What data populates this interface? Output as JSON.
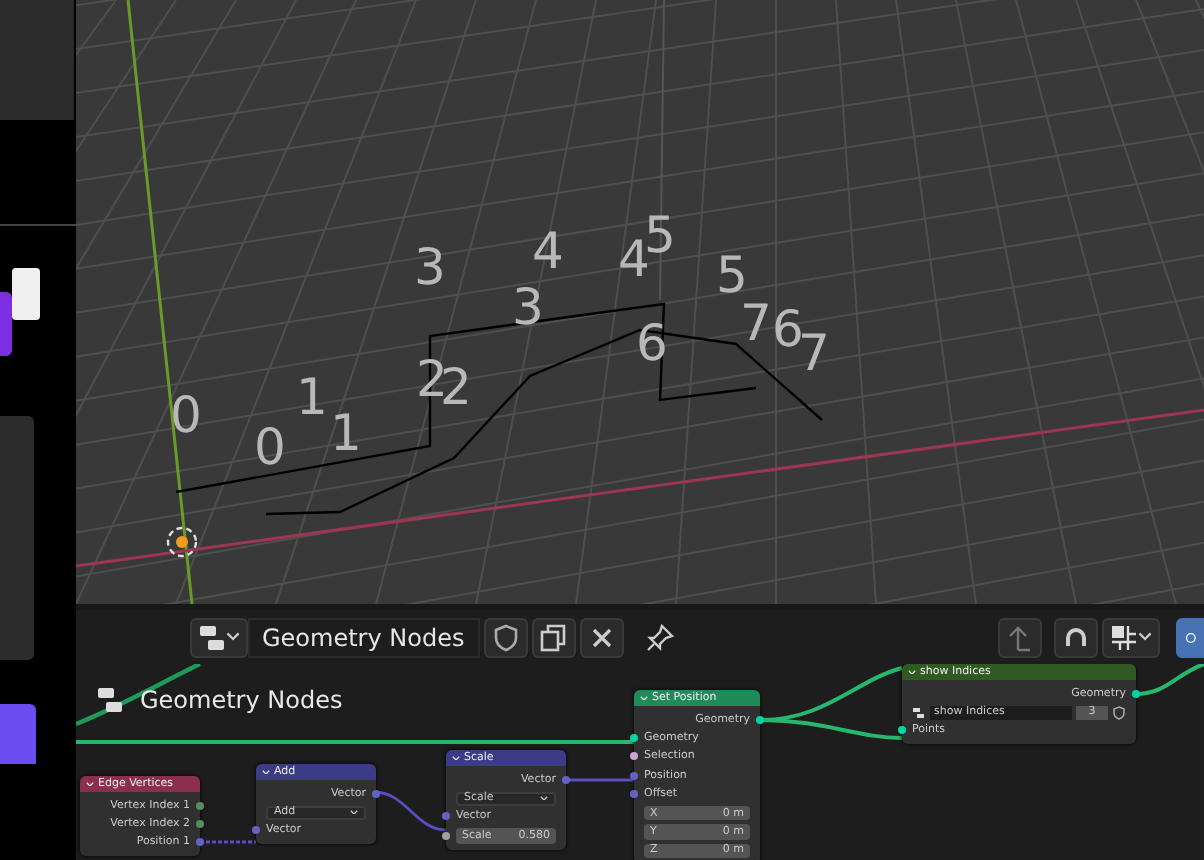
{
  "viewport": {
    "index_labels": [
      {
        "text": "0"
      },
      {
        "text": "0"
      },
      {
        "text": "1"
      },
      {
        "text": "1"
      },
      {
        "text": "2"
      },
      {
        "text": "2"
      },
      {
        "text": "3"
      },
      {
        "text": "3"
      },
      {
        "text": "4"
      },
      {
        "text": "4"
      },
      {
        "text": "5"
      },
      {
        "text": "5"
      },
      {
        "text": "6"
      },
      {
        "text": "7"
      },
      {
        "text": "6"
      },
      {
        "text": "7"
      }
    ]
  },
  "node_editor": {
    "header": {
      "tree_name": "Geometry Nodes"
    },
    "breadcrumb": "Geometry Nodes",
    "nodes": [
      {
        "title": "Edge Vertices",
        "kind": "field",
        "rows": [
          {
            "kind": "output",
            "label": "Vertex Index 1",
            "color": "#598c5c"
          },
          {
            "kind": "output",
            "label": "Vertex Index 2",
            "color": "#598c5c"
          },
          {
            "kind": "output",
            "label": "Position 1",
            "color": "#6363c7"
          }
        ]
      },
      {
        "title": "Add",
        "kind": "vector",
        "rows": [
          {
            "kind": "output",
            "label": "Vector",
            "color": "#6363c7"
          },
          {
            "kind": "dropdown",
            "label": "Add"
          },
          {
            "kind": "input",
            "label": "Vector",
            "color": "#6363c7"
          }
        ]
      },
      {
        "title": "Scale",
        "kind": "vector",
        "rows": [
          {
            "kind": "output",
            "label": "Vector",
            "color": "#6363c7"
          },
          {
            "kind": "dropdown",
            "label": "Scale"
          },
          {
            "kind": "input",
            "label": "Vector",
            "color": "#6363c7"
          },
          {
            "kind": "field",
            "label": "Scale",
            "value": "0.580",
            "color": "#a1a1a1"
          }
        ]
      },
      {
        "title": "Set Position",
        "kind": "geometry",
        "rows": [
          {
            "kind": "output",
            "label": "Geometry",
            "color": "#00d6a3"
          },
          {
            "kind": "input",
            "label": "Geometry",
            "color": "#00d6a3"
          },
          {
            "kind": "input",
            "label": "Selection",
            "color": "#cca6d6"
          },
          {
            "kind": "input",
            "label": "Position",
            "color": "#6363c7"
          },
          {
            "kind": "input",
            "label": "Offset",
            "color": "#6363c7"
          },
          {
            "kind": "field",
            "label": "X",
            "value": "0 m"
          },
          {
            "kind": "field",
            "label": "Y",
            "value": "0 m"
          },
          {
            "kind": "field",
            "label": "Z",
            "value": "0 m"
          }
        ]
      },
      {
        "title": "show Indices",
        "kind": "group",
        "rows": [
          {
            "kind": "output",
            "label": "Geometry",
            "color": "#00d6a3"
          },
          {
            "kind": "group-select",
            "label": "show Indices",
            "value": "3"
          },
          {
            "kind": "input",
            "label": "Points",
            "color": "#00d6a3"
          }
        ]
      }
    ]
  }
}
